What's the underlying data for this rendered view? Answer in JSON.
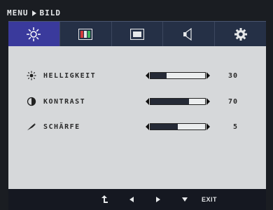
{
  "breadcrumb": {
    "menu": "MENU",
    "page": "BILD"
  },
  "tabs": [
    {
      "icon": "brightness-icon",
      "active": true
    },
    {
      "icon": "color-icon",
      "active": false
    },
    {
      "icon": "screen-icon",
      "active": false
    },
    {
      "icon": "speaker-icon",
      "active": false
    },
    {
      "icon": "gear-icon",
      "active": false
    }
  ],
  "settings": [
    {
      "label": "HELLIGKEIT",
      "value": "30",
      "level": 0.3,
      "icon": "sun-icon"
    },
    {
      "label": "KONTRAST",
      "value": "70",
      "level": 0.7,
      "icon": "contrast-icon"
    },
    {
      "label": "SCHÄRFE",
      "value": "5",
      "level": 0.5,
      "icon": "sharpness-icon"
    }
  ],
  "footer": {
    "exit_label": "EXIT"
  },
  "colors": {
    "active_tab": "#3a3a9c",
    "tabbar": "#253046",
    "panel": "#d6d8da",
    "fill": "#252a36"
  }
}
